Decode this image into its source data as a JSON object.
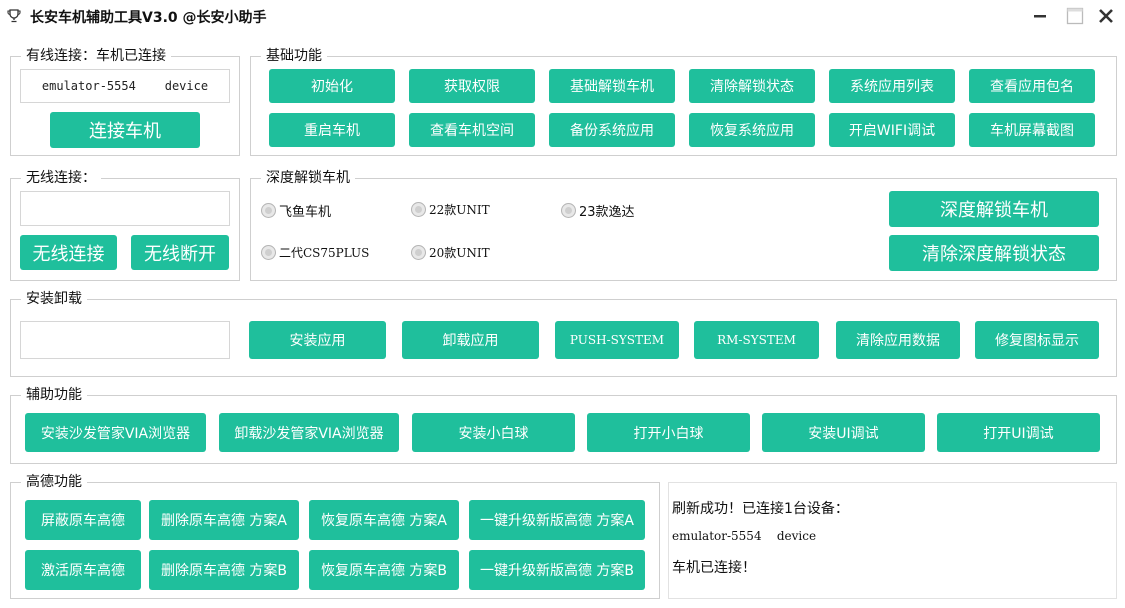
{
  "window": {
    "title": "长安车机辅助工具V3.0 @长安小助手",
    "icon": "trophy-icon",
    "accent_color": "#1fbf9c"
  },
  "wired": {
    "title": "有线连接：车机已连接",
    "device_value": "emulator-5554    device",
    "connect_button": "连接车机"
  },
  "basic": {
    "title": "基础功能",
    "row1": [
      "初始化",
      "获取权限",
      "基础解锁车机",
      "清除解锁状态",
      "系统应用列表",
      "查看应用包名"
    ],
    "row2": [
      "重启车机",
      "查看车机空间",
      "备份系统应用",
      "恢复系统应用",
      "开启WIFI调试",
      "车机屏幕截图"
    ]
  },
  "wireless": {
    "title": "无线连接：",
    "address_value": "",
    "connect_button": "无线连接",
    "disconnect_button": "无线断开"
  },
  "deep": {
    "title": "深度解锁车机",
    "options": [
      "飞鱼车机",
      "22款UNIT",
      "23款逸达",
      "二代CS75PLUS",
      "20款UNIT"
    ],
    "unlock_button": "深度解锁车机",
    "clear_button": "清除深度解锁状态"
  },
  "install": {
    "title": "安装卸载",
    "path_value": "",
    "buttons": [
      "安装应用",
      "卸载应用",
      "PUSH-SYSTEM",
      "RM-SYSTEM",
      "清除应用数据",
      "修复图标显示"
    ]
  },
  "aux": {
    "title": "辅助功能",
    "buttons": [
      "安装沙发管家VIA浏览器",
      "卸载沙发管家VIA浏览器",
      "安装小白球",
      "打开小白球",
      "安装UI调试",
      "打开UI调试"
    ]
  },
  "amap": {
    "title": "高德功能",
    "row1": [
      "屏蔽原车高德",
      "删除原车高德 方案A",
      "恢复原车高德 方案A",
      "一键升级新版高德 方案A"
    ],
    "row2": [
      "激活原车高德",
      "删除原车高德 方案B",
      "恢复原车高德 方案B",
      "一键升级新版高德 方案B"
    ]
  },
  "log": {
    "line1": "刷新成功！已连接1台设备：",
    "line2": "emulator-5554    device",
    "line3": "车机已连接！"
  }
}
